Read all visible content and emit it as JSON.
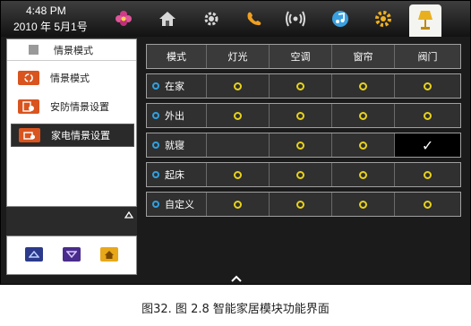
{
  "status": {
    "time": "4:48 PM",
    "date": "2010 年 5月1号"
  },
  "top_icons": [
    {
      "name": "flower-icon",
      "color": "#d13a8a"
    },
    {
      "name": "home-icon",
      "color": "#d8d8d8"
    },
    {
      "name": "gear-icon",
      "color": "#d8d8d8"
    },
    {
      "name": "phone-icon",
      "color": "#f0a020"
    },
    {
      "name": "wireless-icon",
      "color": "#d8d8d8"
    },
    {
      "name": "music-icon",
      "color": "#3aa0e0"
    },
    {
      "name": "settings-gear-icon",
      "color": "#f0b020"
    },
    {
      "name": "lamp-icon",
      "color": "#e8b020"
    }
  ],
  "left_panel": {
    "header": "情景模式",
    "items": [
      {
        "label": "情景模式"
      },
      {
        "label": "安防情景设置"
      },
      {
        "label": "家电情景设置"
      }
    ],
    "selected_index": 2
  },
  "table": {
    "headers": [
      "模式",
      "灯光",
      "空调",
      "窗帘",
      "阀门"
    ],
    "rows": [
      {
        "mode": "在家",
        "cells": [
          "ring",
          "ring",
          "ring",
          "ring"
        ]
      },
      {
        "mode": "外出",
        "cells": [
          "ring",
          "ring",
          "ring",
          "ring"
        ]
      },
      {
        "mode": "就寝",
        "cells": [
          "",
          "ring",
          "ring",
          "check"
        ]
      },
      {
        "mode": "起床",
        "cells": [
          "ring",
          "ring",
          "ring",
          "ring"
        ]
      },
      {
        "mode": "自定义",
        "cells": [
          "ring",
          "ring",
          "ring",
          "ring"
        ]
      }
    ]
  },
  "check_glyph": "✓",
  "caption": "图32. 图 2.8 智能家居模块功能界面",
  "colors": {
    "accent_orange": "#d9541e",
    "ring_yellow": "#e8d21a",
    "dot_blue": "#2fa0e0"
  }
}
